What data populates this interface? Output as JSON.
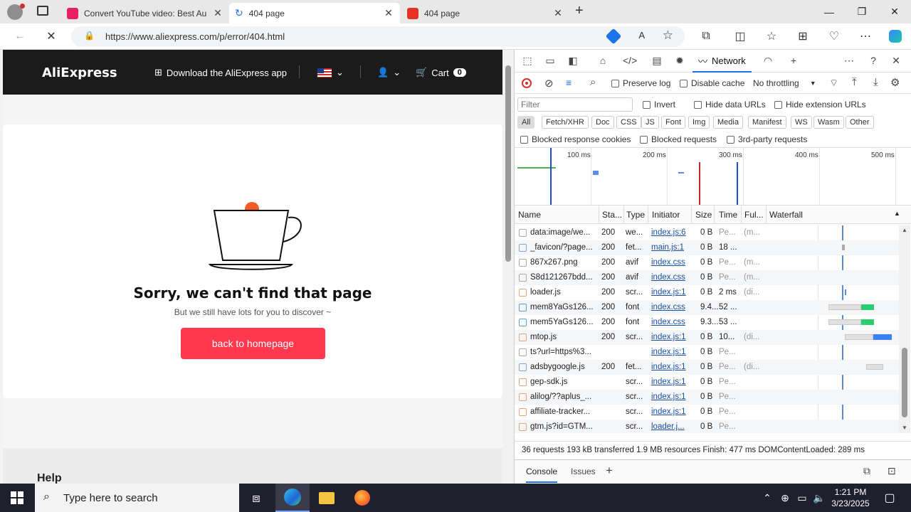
{
  "tabs": [
    {
      "title": "Convert YouTube video: Best Au",
      "active": false
    },
    {
      "title": "404 page",
      "active": true
    },
    {
      "title": "404 page",
      "active": false
    }
  ],
  "address": {
    "url": "https://www.aliexpress.com/p/error/404.html"
  },
  "page": {
    "logo": "AliExpress",
    "download_app": "Download the AliExpress app",
    "cart_label": "Cart",
    "cart_count": "0",
    "error_title": "Sorry, we can't find that page",
    "error_subtitle": "But we still have lots for you to discover ~",
    "home_button": "back to homepage",
    "footer_heading": "Help"
  },
  "devtools": {
    "network_tab": "Network",
    "controls": {
      "preserve_log": "Preserve log",
      "disable_cache": "Disable cache",
      "throttling": "No throttling"
    },
    "filter_placeholder": "Filter",
    "invert": "Invert",
    "hide_data_urls": "Hide data URLs",
    "hide_extension_urls": "Hide extension URLs",
    "type_filters": [
      "All",
      "Fetch/XHR",
      "Doc",
      "CSS",
      "JS",
      "Font",
      "Img",
      "Media",
      "Manifest",
      "WS",
      "Wasm",
      "Other"
    ],
    "blocked_response_cookies": "Blocked response cookies",
    "blocked_requests": "Blocked requests",
    "third_party_requests": "3rd-party requests",
    "timeline_ticks": [
      "100 ms",
      "200 ms",
      "300 ms",
      "400 ms",
      "500 ms"
    ],
    "columns": [
      "Name",
      "Sta...",
      "Type",
      "Initiator",
      "Size",
      "Time",
      "Ful...",
      "Waterfall"
    ],
    "requests": [
      {
        "name": "data:image/we...",
        "status": "200",
        "type": "we...",
        "initiator": "index.js:6",
        "size": "0 B",
        "time": "Pe...",
        "full": "(m..."
      },
      {
        "name": "_favicon/?page...",
        "status": "200",
        "type": "fet...",
        "initiator": "main.js:1",
        "size": "0 B",
        "time": "18 ...",
        "full": ""
      },
      {
        "name": "867x267.png",
        "status": "200",
        "type": "avif",
        "initiator": "index.css",
        "size": "0 B",
        "time": "Pe...",
        "full": "(m..."
      },
      {
        "name": "S8d121267bdd...",
        "status": "200",
        "type": "avif",
        "initiator": "index.css",
        "size": "0 B",
        "time": "Pe...",
        "full": "(m..."
      },
      {
        "name": "loader.js",
        "status": "200",
        "type": "scr...",
        "initiator": "index.js:1",
        "size": "0 B",
        "time": "2 ms",
        "full": "(di..."
      },
      {
        "name": "mem8YaGs126...",
        "status": "200",
        "type": "font",
        "initiator": "index.css",
        "size": "9.4...",
        "time": "52 ...",
        "full": ""
      },
      {
        "name": "mem5YaGs126...",
        "status": "200",
        "type": "font",
        "initiator": "index.css",
        "size": "9.3...",
        "time": "53 ...",
        "full": ""
      },
      {
        "name": "mtop.js",
        "status": "200",
        "type": "scr...",
        "initiator": "index.js:1",
        "size": "0 B",
        "time": "10...",
        "full": "(di..."
      },
      {
        "name": "ts?url=https%3...",
        "status": "",
        "type": "",
        "initiator": "index.js:1",
        "size": "0 B",
        "time": "Pe...",
        "full": ""
      },
      {
        "name": "adsbygoogle.js",
        "status": "200",
        "type": "fet...",
        "initiator": "index.js:1",
        "size": "0 B",
        "time": "Pe...",
        "full": "(di..."
      },
      {
        "name": "gep-sdk.js",
        "status": "",
        "type": "scr...",
        "initiator": "index.js:1",
        "size": "0 B",
        "time": "Pe...",
        "full": ""
      },
      {
        "name": "alilog/??aplus_...",
        "status": "",
        "type": "scr...",
        "initiator": "index.js:1",
        "size": "0 B",
        "time": "Pe...",
        "full": ""
      },
      {
        "name": "affiliate-tracker...",
        "status": "",
        "type": "scr...",
        "initiator": "index.js:1",
        "size": "0 B",
        "time": "Pe...",
        "full": ""
      },
      {
        "name": "gtm.js?id=GTM...",
        "status": "",
        "type": "scr...",
        "initiator": "loader.j...",
        "size": "0 B",
        "time": "Pe...",
        "full": ""
      }
    ],
    "status_bar": "36 requests  193 kB transferred  1.9 MB resources  Finish: 477 ms  DOMContentLoaded: 289 ms",
    "drawer_tabs": [
      "Console",
      "Issues"
    ]
  },
  "taskbar": {
    "search_placeholder": "Type here to search",
    "time": "1:21 PM",
    "date": "3/23/2025"
  },
  "colors": {
    "accent": "#fd384f",
    "network_underline": "#1a73e8",
    "taskbar": "#1f1f2e"
  }
}
